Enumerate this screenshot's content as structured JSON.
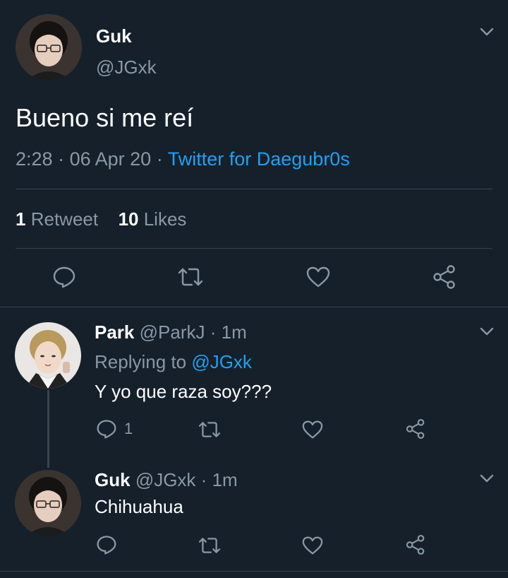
{
  "main_tweet": {
    "display_name": "Guk",
    "handle": "@JGxk",
    "text": "Bueno si me reí",
    "time": "2:28",
    "sep1": "·",
    "date": "06 Apr 20",
    "sep2": "·",
    "source": "Twitter for Daegubr0s",
    "retweet_count": "1",
    "retweet_label": "Retweet",
    "like_count": "10",
    "like_label": "Likes"
  },
  "replies": [
    {
      "display_name": "Park",
      "handle": "@ParkJ",
      "sep": "·",
      "time": "1m",
      "replying_prefix": "Replying to",
      "replying_to": "@JGxk",
      "text": "Y yo que raza soy???",
      "reply_count": "1"
    },
    {
      "display_name": "Guk",
      "handle": "@JGxk",
      "sep": "·",
      "time": "1m",
      "text": "Chihuahua"
    }
  ],
  "colors": {
    "background": "#15202b",
    "muted": "#8899a6",
    "accent": "#1da1f2",
    "divider": "#38444d"
  }
}
